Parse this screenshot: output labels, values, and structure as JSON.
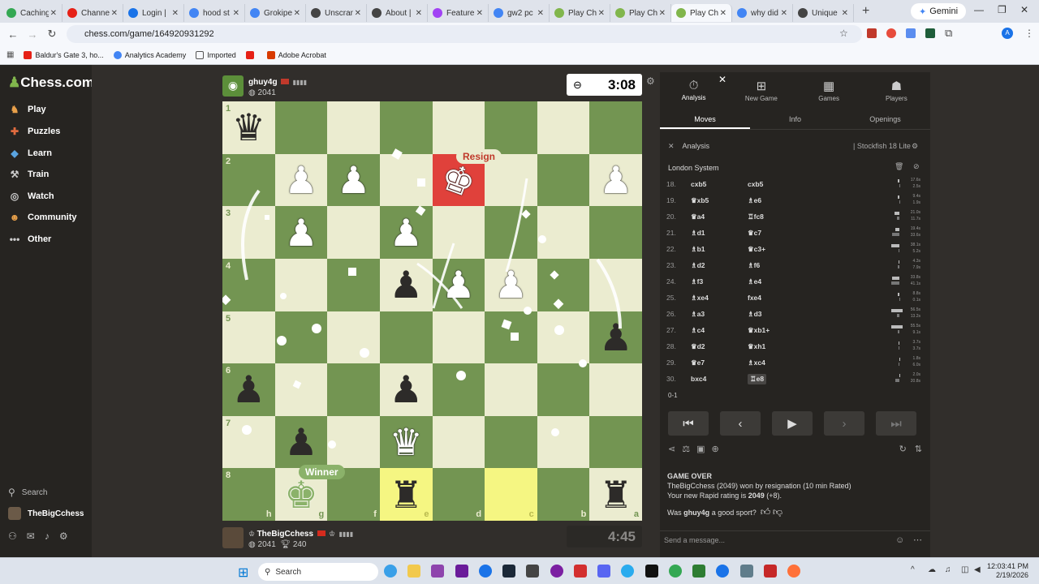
{
  "browser": {
    "tabs": [
      {
        "label": "Caching",
        "color": "#34a853"
      },
      {
        "label": "Channe",
        "color": "#e62117"
      },
      {
        "label": "Login |",
        "color": "#1a73e8"
      },
      {
        "label": "hood st",
        "color": "#4285f4"
      },
      {
        "label": "Grokipe",
        "color": "#4285f4"
      },
      {
        "label": "Unscran",
        "color": "#444444"
      },
      {
        "label": "About |",
        "color": "#444444"
      },
      {
        "label": "Feature",
        "color": "#a142f4"
      },
      {
        "label": "gw2 pc",
        "color": "#4285f4"
      },
      {
        "label": "Play Ch",
        "color": "#81b64c"
      },
      {
        "label": "Play Ch",
        "color": "#81b64c"
      },
      {
        "label": "Play Ch",
        "color": "#81b64c",
        "active": true
      },
      {
        "label": "why did",
        "color": "#4285f4"
      },
      {
        "label": "Unique",
        "color": "#444444"
      }
    ],
    "gemini_label": "Gemini",
    "url": "chess.com/game/164920931292",
    "bookmarks": [
      "Baldur's Gate 3, ho...",
      "Analytics Academy",
      "Imported",
      "",
      "Adobe Acrobat"
    ]
  },
  "nav": {
    "logo": "Chess.com",
    "items": [
      "Play",
      "Puzzles",
      "Learn",
      "Train",
      "Watch",
      "Community",
      "Other"
    ],
    "search": "Search",
    "user": "TheBigCchess"
  },
  "top_player": {
    "name": "ghuy4g",
    "rating": "2041",
    "clock": "3:08"
  },
  "bottom_player": {
    "name": "TheBigCchess",
    "rating": "2041",
    "trophies": "240",
    "clock": "4:45"
  },
  "board": {
    "resign_label": "Resign",
    "winner_label": "Winner",
    "ranks": [
      "1",
      "2",
      "3",
      "4",
      "5",
      "6",
      "7",
      "8"
    ],
    "files": [
      "h",
      "g",
      "f",
      "e",
      "d",
      "c",
      "b",
      "a"
    ]
  },
  "panel": {
    "tabs": [
      "Analysis",
      "New Game",
      "Games",
      "Players"
    ],
    "subtabs": [
      "Moves",
      "Info",
      "Openings"
    ],
    "analysis_label": "Analysis",
    "engine": "Stockfish 18 Lite",
    "opening": "London System",
    "moves": [
      {
        "n": "18.",
        "w": "cxb5",
        "b": "cxb5",
        "tw": "17.6s",
        "tb": "2.5s",
        "bw": 0.2,
        "bb": 0.05
      },
      {
        "n": "19.",
        "w": "♛xb5",
        "b": "♗e6",
        "tw": "9.4s",
        "tb": "1.9s",
        "bw": 0.2,
        "bb": 0.05
      },
      {
        "n": "20.",
        "w": "♛a4",
        "b": "♖fc8",
        "tw": "21.0s",
        "tb": "11.7s",
        "bw": 0.6,
        "bb": 0.35
      },
      {
        "n": "21.",
        "w": "♗d1",
        "b": "♛c7",
        "tw": "19.4s",
        "tb": "33.6s",
        "bw": 0.55,
        "bb": 0.9
      },
      {
        "n": "22.",
        "w": "♗b1",
        "b": "♛c3+",
        "tw": "38.1s",
        "tb": "5.2s",
        "bw": 1.0,
        "bb": 0.15
      },
      {
        "n": "23.",
        "w": "♗d2",
        "b": "♗f6",
        "tw": "4.3s",
        "tb": "7.9s",
        "bw": 0.12,
        "bb": 0.2
      },
      {
        "n": "24.",
        "w": "♗f3",
        "b": "♗e4",
        "tw": "33.8s",
        "tb": "41.1s",
        "bw": 0.9,
        "bb": 1.0
      },
      {
        "n": "25.",
        "w": "♗xe4",
        "b": "fxe4",
        "tw": "8.8s",
        "tb": "0.1s",
        "bw": 0.25,
        "bb": 0.02
      },
      {
        "n": "26.",
        "w": "♗a3",
        "b": "♗d3",
        "tw": "56.5s",
        "tb": "13.2s",
        "bw": 1.4,
        "bb": 0.35
      },
      {
        "n": "27.",
        "w": "♗c4",
        "b": "♛xb1+",
        "tw": "55.5s",
        "tb": "9.1s",
        "bw": 1.4,
        "bb": 0.25
      },
      {
        "n": "28.",
        "w": "♛d2",
        "b": "♛xh1",
        "tw": "3.7s",
        "tb": "3.7s",
        "bw": 0.1,
        "bb": 0.1
      },
      {
        "n": "29.",
        "w": "♛e7",
        "b": "♗xc4",
        "tw": "1.8s",
        "tb": "6.0s",
        "bw": 0.05,
        "bb": 0.15
      },
      {
        "n": "30.",
        "w": "bxc4",
        "b": "♖e8",
        "tw": "2.0s",
        "tb": "20.8s",
        "bw": 0.05,
        "bb": 0.55
      }
    ],
    "result": "0-1",
    "gameover": {
      "title": "GAME OVER",
      "line1": "TheBigCchess (2049) won by resignation (10 min Rated)",
      "line2_prefix": "Your new Rapid rating is ",
      "line2_rating": "2049",
      "line2_suffix": " (+8).",
      "question_prefix": "Was ",
      "question_name": "ghuy4g",
      "question_suffix": " a good sport?"
    },
    "send_placeholder": "Send a message..."
  },
  "taskbar": {
    "search": "Search",
    "time": "12:03:41 PM",
    "date": "2/19/2026"
  }
}
